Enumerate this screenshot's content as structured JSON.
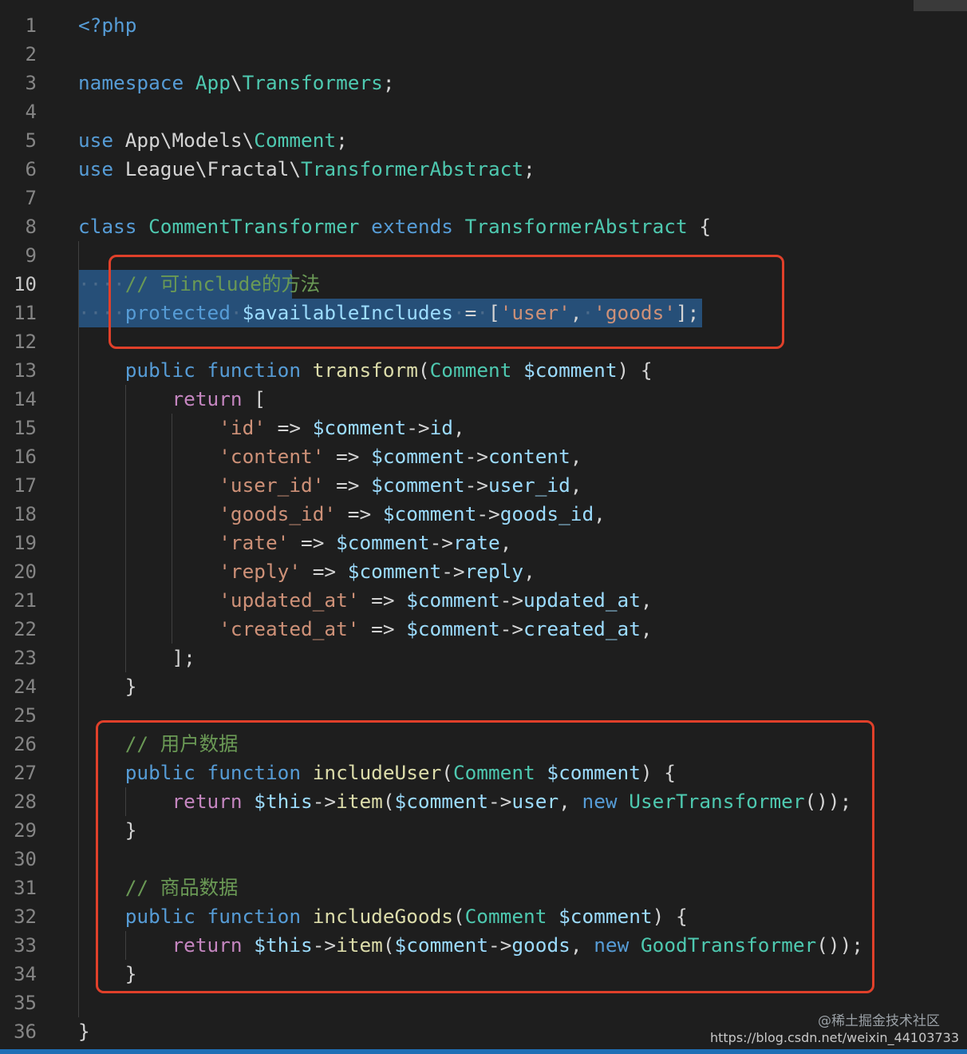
{
  "editor": {
    "colors": {
      "background": "#1e1e1e",
      "keyword": "#569cd6",
      "control": "#c586c0",
      "type": "#4ec9b0",
      "variable": "#9cdcfe",
      "function": "#dcdcaa",
      "string": "#ce9178",
      "comment": "#6a9955",
      "highlight_box": "#e0402a",
      "selection": "#264f78"
    },
    "lines": [
      {
        "n": "1",
        "code": "<?php"
      },
      {
        "n": "2",
        "code": ""
      },
      {
        "n": "3",
        "code": "namespace App\\Transformers;"
      },
      {
        "n": "4",
        "code": ""
      },
      {
        "n": "5",
        "code": "use App\\Models\\Comment;"
      },
      {
        "n": "6",
        "code": "use League\\Fractal\\TransformerAbstract;"
      },
      {
        "n": "7",
        "code": ""
      },
      {
        "n": "8",
        "code": "class CommentTransformer extends TransformerAbstract {"
      },
      {
        "n": "9",
        "code": ""
      },
      {
        "n": "10",
        "code": "    // 可include的方法"
      },
      {
        "n": "11",
        "code": "    protected $availableIncludes = ['user', 'goods'];"
      },
      {
        "n": "12",
        "code": ""
      },
      {
        "n": "13",
        "code": "    public function transform(Comment $comment) {"
      },
      {
        "n": "14",
        "code": "        return ["
      },
      {
        "n": "15",
        "code": "            'id' => $comment->id,"
      },
      {
        "n": "16",
        "code": "            'content' => $comment->content,"
      },
      {
        "n": "17",
        "code": "            'user_id' => $comment->user_id,"
      },
      {
        "n": "18",
        "code": "            'goods_id' => $comment->goods_id,"
      },
      {
        "n": "19",
        "code": "            'rate' => $comment->rate,"
      },
      {
        "n": "20",
        "code": "            'reply' => $comment->reply,"
      },
      {
        "n": "21",
        "code": "            'updated_at' => $comment->updated_at,"
      },
      {
        "n": "22",
        "code": "            'created_at' => $comment->created_at,"
      },
      {
        "n": "23",
        "code": "        ];"
      },
      {
        "n": "24",
        "code": "    }"
      },
      {
        "n": "25",
        "code": ""
      },
      {
        "n": "26",
        "code": "    // 用户数据"
      },
      {
        "n": "27",
        "code": "    public function includeUser(Comment $comment) {"
      },
      {
        "n": "28",
        "code": "        return $this->item($comment->user, new UserTransformer());"
      },
      {
        "n": "29",
        "code": "    }"
      },
      {
        "n": "30",
        "code": ""
      },
      {
        "n": "31",
        "code": "    // 商品数据"
      },
      {
        "n": "32",
        "code": "    public function includeGoods(Comment $comment) {"
      },
      {
        "n": "33",
        "code": "        return $this->item($comment->goods, new GoodTransformer());"
      },
      {
        "n": "34",
        "code": "    }"
      },
      {
        "n": "35",
        "code": ""
      },
      {
        "n": "36",
        "code": "}"
      }
    ],
    "active_line": "10"
  },
  "watermark": {
    "line1": "@稀土掘金技术社区",
    "line2": "https://blog.csdn.net/weixin_44103733"
  }
}
